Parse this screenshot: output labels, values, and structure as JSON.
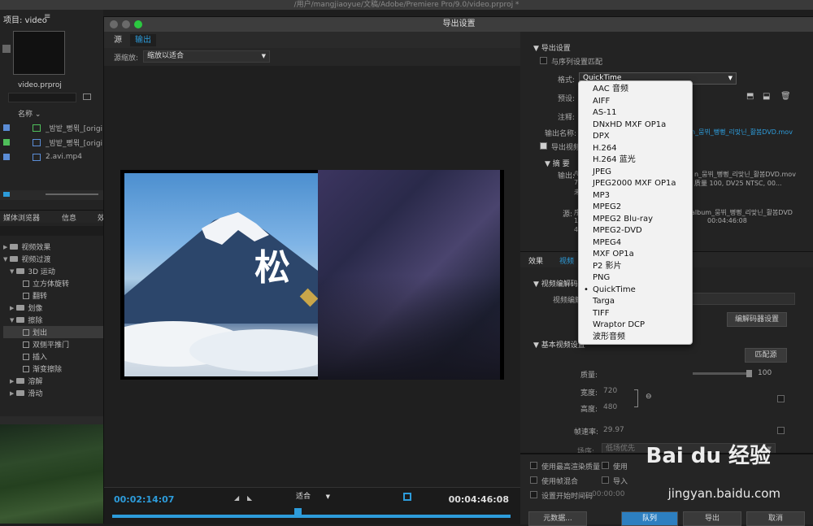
{
  "os_title": "/用户/mangjiaoyue/文稿/Adobe/Premiere Pro/9.0/video.prproj *",
  "project": {
    "title": "项目: video",
    "file": "video.prproj",
    "name_header": "名称",
    "items": [
      {
        "label": "_밤밭_뻥뫾_[origi",
        "color": "#5b8dd6"
      },
      {
        "label": "_밤밭_뻥뫾_[origi",
        "color": "#4fbf5a"
      },
      {
        "label": "2.avi.mp4",
        "color": "#5b8dd6"
      }
    ]
  },
  "effects_panel": {
    "tabs": [
      "媒体浏览器",
      "信息",
      "效"
    ],
    "tree": [
      {
        "label": "视频效果",
        "kind": "folder",
        "depth": 0
      },
      {
        "label": "视频过渡",
        "kind": "folder",
        "depth": 0,
        "open": true
      },
      {
        "label": "3D 运动",
        "kind": "folder",
        "depth": 1,
        "open": true
      },
      {
        "label": "立方体旋转",
        "kind": "fx",
        "depth": 2
      },
      {
        "label": "翻转",
        "kind": "fx",
        "depth": 2
      },
      {
        "label": "划像",
        "kind": "folder",
        "depth": 1
      },
      {
        "label": "擦除",
        "kind": "folder",
        "depth": 1,
        "open": true
      },
      {
        "label": "划出",
        "kind": "fx",
        "depth": 2,
        "selected": true
      },
      {
        "label": "双侧平推门",
        "kind": "fx",
        "depth": 2
      },
      {
        "label": "插入",
        "kind": "fx",
        "depth": 2
      },
      {
        "label": "渐变擦除",
        "kind": "fx",
        "depth": 2
      },
      {
        "label": "溶解",
        "kind": "folder",
        "depth": 1
      },
      {
        "label": "滑动",
        "kind": "folder",
        "depth": 1
      }
    ]
  },
  "dialog": {
    "title": "导出设置",
    "tabs": [
      "源",
      "输出"
    ],
    "scale_label": "源缩放:",
    "scale_value": "缩放以适合",
    "preview_char": "松",
    "timecode_start": "00:02:14:07",
    "timecode_end": "00:04:46:08",
    "fit": "适合"
  },
  "export": {
    "section": "导出设置",
    "match_seq": "与序列设置匹配",
    "format_label": "格式:",
    "format_value": "QuickTime",
    "preset_label": "预设:",
    "comment_label": "注释:",
    "output_name_label": "输出名称:",
    "output_name_value": "n_뭄뷔_뻥뻥_리맞닌_활봄DVD.mov",
    "export_video": "导出视频",
    "summary": "摘 要",
    "output_label": "输出:",
    "output_lines": [
      "/U",
      "72",
      "未"
    ],
    "output_right": [
      "n_뭄뷔_뻥뻥_리맞닌_활봄DVD.mov",
      "质量 100, DV25 NTSC, 00..."
    ],
    "source_label": "源:",
    "source_lines": [
      "序",
      "12",
      "44"
    ],
    "source_right": [
      "album_뭄뷔_뻥뻥_리맞닌_활봄DVD",
      "00:04:46:08"
    ]
  },
  "format_menu": [
    "AAC 音频",
    "AIFF",
    "AS-11",
    "DNxHD MXF OP1a",
    "DPX",
    "H.264",
    "H.264 蓝光",
    "JPEG",
    "JPEG2000 MXF OP1a",
    "MP3",
    "MPEG2",
    "MPEG2 Blu-ray",
    "MPEG2-DVD",
    "MPEG4",
    "MXF OP1a",
    "P2 影片",
    "PNG",
    "QuickTime",
    "Targa",
    "TIFF",
    "Wraptor DCP",
    "波形音频"
  ],
  "format_selected": "QuickTime",
  "settings": {
    "tabs": [
      "效果",
      "视频"
    ],
    "codec_header": "视频编解码",
    "codec_label": "视频编解",
    "codec_settings": "编解码器设置",
    "basic_header": "基本视频设置",
    "match_source": "匹配源",
    "quality_label": "质量:",
    "quality_value": "100",
    "width_label": "宽度:",
    "width_value": "720",
    "height_label": "高度:",
    "height_value": "480",
    "fps_label": "帧速率:",
    "fps_value": "29.97",
    "field_label": "场序:",
    "field_value": "低场优先"
  },
  "bottom": {
    "max_quality": "使用最高渲染质量",
    "use_preview": "使用",
    "frame_blend": "使用帧混合",
    "import": "导入",
    "start_tc": "设置开始时间码",
    "start_tc_value": "00:00:00",
    "metadata": "元数据...",
    "queue": "队列",
    "export": "导出",
    "cancel": "取消"
  },
  "watermark": {
    "logo": "Bai du 经验",
    "url": "jingyan.baidu.com"
  },
  "colors": {
    "accent": "#2d9cdb",
    "panel": "#232323",
    "menu_bg": "#f2f2f2"
  }
}
